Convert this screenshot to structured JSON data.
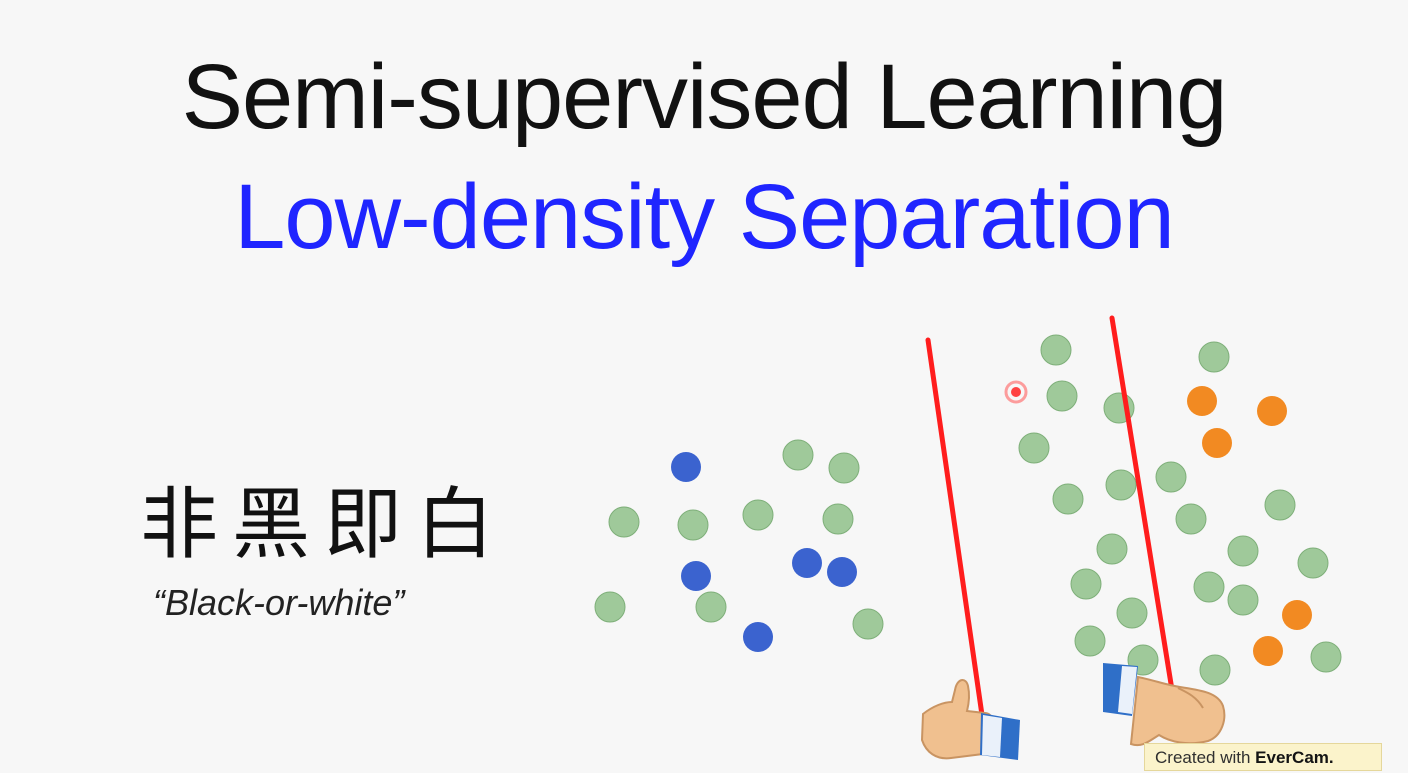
{
  "slide": {
    "title": "Semi-supervised Learning",
    "subtitle": "Low-density Separation",
    "chinese": "非黑即白",
    "english": "“Black-or-white”"
  },
  "watermark": {
    "prefix": "Created with",
    "brand": "EverCam."
  },
  "colors": {
    "labeled_class_1": "#3b63cf",
    "unlabeled": "#9fc99a",
    "labeled_class_2": "#f28a22",
    "boundary_line": "#ff1d1d",
    "subtitle": "#1f25ff"
  }
}
